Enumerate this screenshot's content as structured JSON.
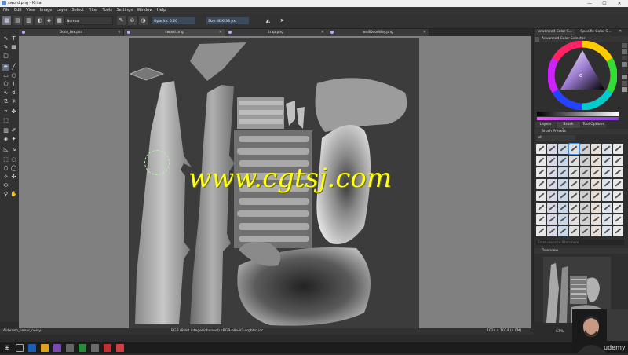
{
  "window": {
    "title": "sword.png - Krita",
    "controls": [
      "—",
      "☐",
      "✕"
    ]
  },
  "menu": [
    "File",
    "Edit",
    "View",
    "Image",
    "Layer",
    "Select",
    "Filter",
    "Tools",
    "Settings",
    "Window",
    "Help"
  ],
  "tool_options": {
    "blend_mode": "Normal",
    "opacity_label": "Opacity:",
    "opacity_value": "0.20",
    "size_label": "Size:",
    "size_value": "826.38 px"
  },
  "tabs": [
    {
      "label": "Door_tex.psd"
    },
    {
      "label": "sword.png"
    },
    {
      "label": "trap.png"
    },
    {
      "label": "wallDoorWay.png"
    }
  ],
  "canvas": {
    "watermark": "www.cgtsj.com"
  },
  "docker": {
    "top_tabs": [
      "Advanced Color S...",
      "Specific Color S..."
    ],
    "color_selector_title": "Advanced Color Selector",
    "mid_tabs": [
      "Layers",
      "Brush Presets",
      "Tool Options"
    ],
    "brush_presets_title": "Brush Presets",
    "tag_filter": "All",
    "search_placeholder": "Enter resource filters here",
    "overview_title": "Overview",
    "zoom": "67%"
  },
  "status": {
    "brush": "Airbrush_linear_noisy",
    "color_info": "RGB (8-bit integer/channel)  sRGB-elle-V2-srgbtrc.icc",
    "doc_size": "1024 x 1024 (4.0M)"
  },
  "webcam": {
    "brand": "udemy"
  },
  "colors": {
    "accent": "#3c4a5c",
    "watermark": "#ffff1a",
    "canvas_bg": "#808080",
    "texture_bg": "#3c3c3c"
  }
}
